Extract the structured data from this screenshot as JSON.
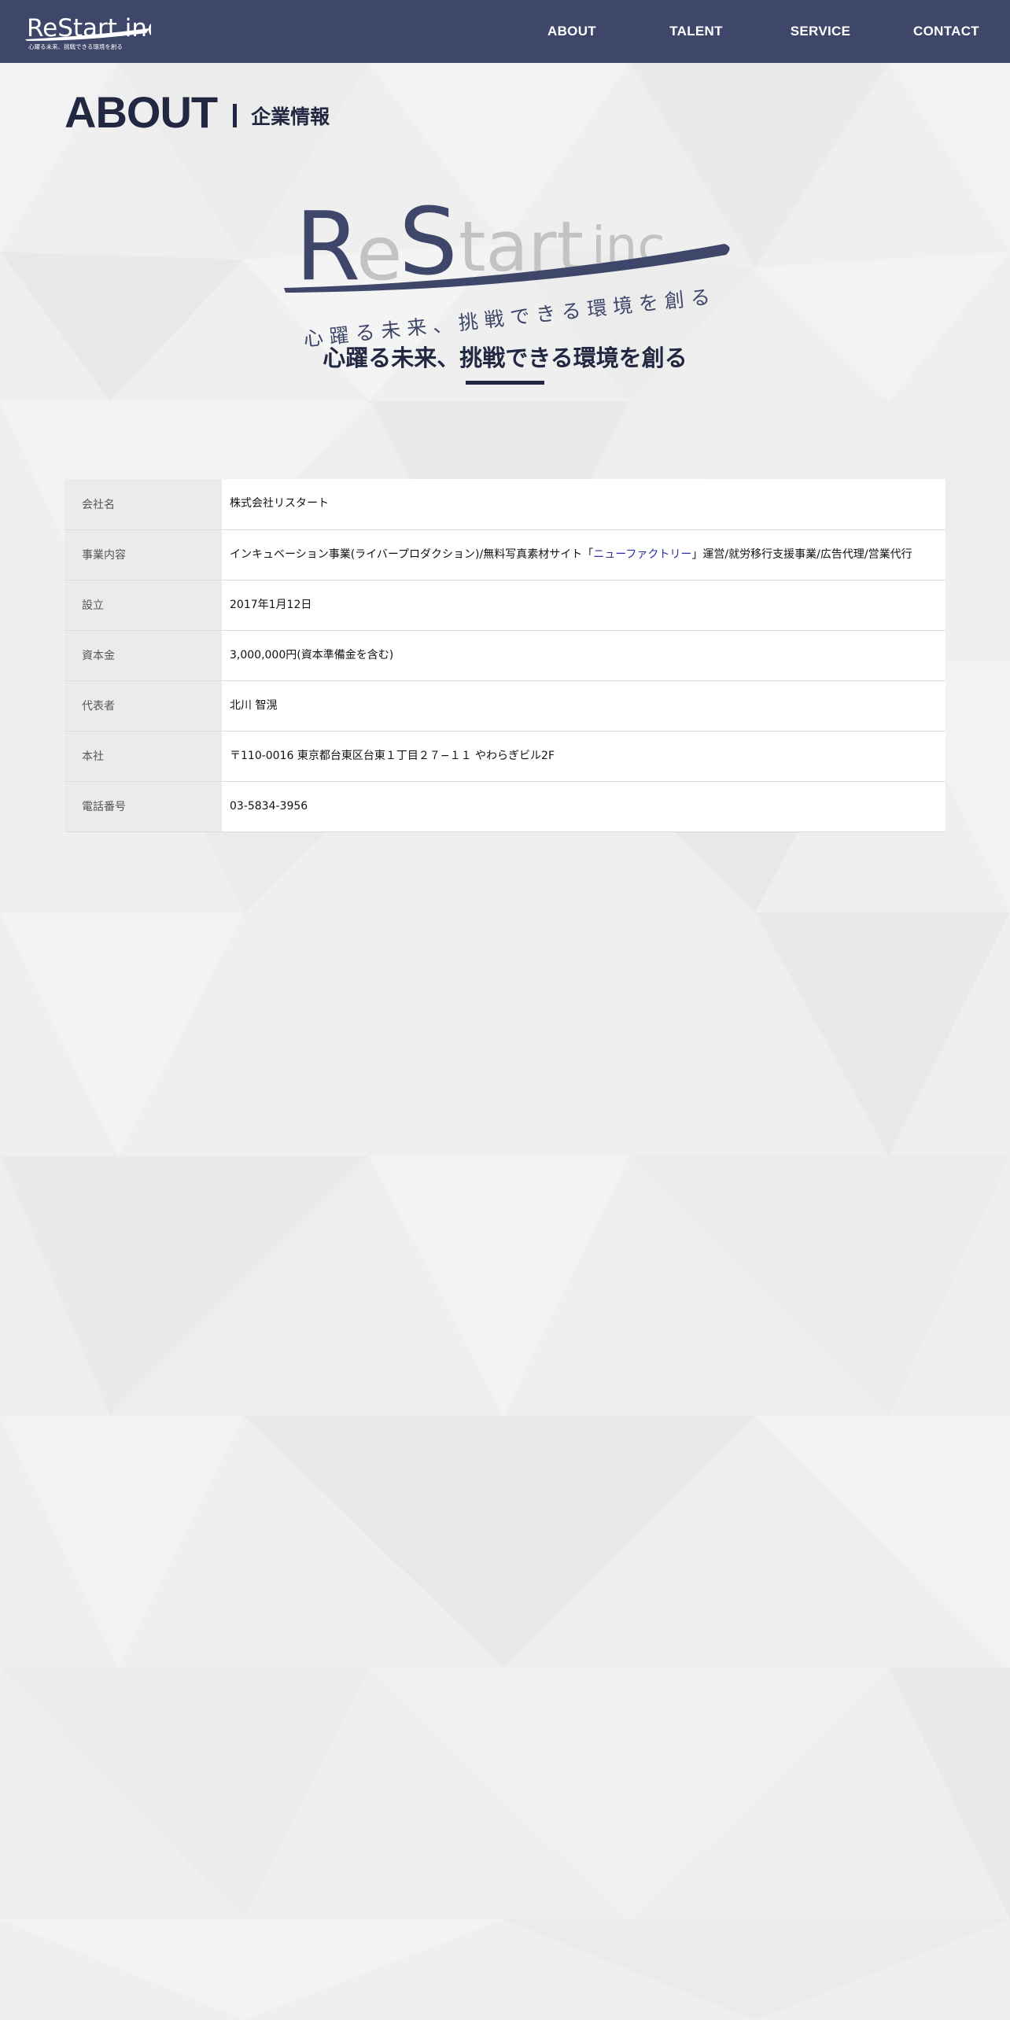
{
  "header": {
    "logo_text": "ReStart inc.",
    "logo_tagline": "心躍る未来、挑戦できる環境を創る",
    "nav": [
      {
        "label": "ABOUT"
      },
      {
        "label": "TALENT"
      },
      {
        "label": "SERVICE"
      },
      {
        "label": "CONTACT"
      }
    ]
  },
  "page": {
    "title_en": "ABOUT",
    "title_ja": "企業情報"
  },
  "hero": {
    "logo_main_r": "R",
    "logo_main_e": "e",
    "logo_main_s": "S",
    "logo_main_tart": "tart",
    "logo_main_inc": "inc.",
    "logo_tagline": "心躍る未来、挑戦できる環境を創る",
    "tagline": "心躍る未来、挑戦できる環境を創る"
  },
  "company_info": {
    "rows": [
      {
        "label": "会社名",
        "value": "株式会社リスタート"
      },
      {
        "label": "事業内容",
        "value_before": "インキュベーション事業(ライバープロダクション)/無料写真素材サイト「",
        "value_link": "ニューファクトリー",
        "value_after": "」運営/就労移行支援事業/広告代理/営業代行"
      },
      {
        "label": "設立",
        "value": "2017年1月12日"
      },
      {
        "label": "資本金",
        "value": "3,000,000円(資本準備金を含む)"
      },
      {
        "label": "代表者",
        "value": "北川 智滉"
      },
      {
        "label": "本社",
        "value": "〒110-0016 東京都台東区台東１丁目２７−１１ やわらぎビル2F"
      },
      {
        "label": "電話番号",
        "value": "03-5834-3956"
      }
    ]
  },
  "colors": {
    "header_bg": "#3e4669",
    "heading_text": "#232842",
    "link": "#2c2f9a"
  }
}
